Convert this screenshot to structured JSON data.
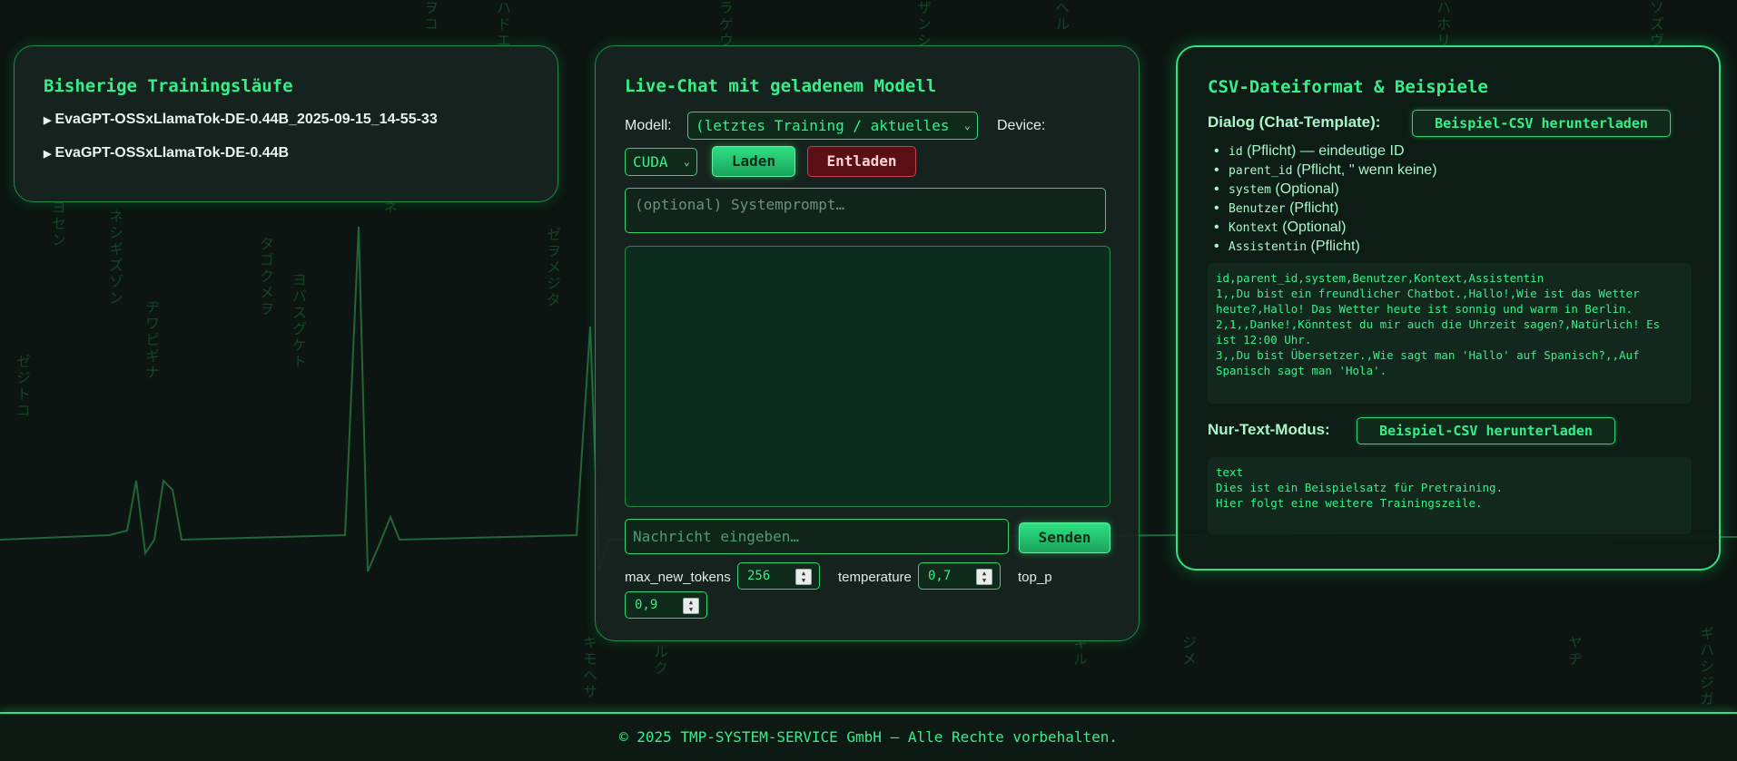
{
  "history": {
    "title": "Bisherige Trainingsläufe",
    "runs": [
      {
        "label": "EvaGPT-OSSxLlamaTok-DE-0.44B_2025-09-15_14-55-33"
      },
      {
        "label": "EvaGPT-OSSxLlamaTok-DE-0.44B"
      }
    ]
  },
  "chat": {
    "title": "Live-Chat mit geladenem Modell",
    "model_label": "Modell:",
    "model_value": "(letztes Training / aktuelles",
    "device_label": "Device:",
    "device_value": "CUDA",
    "load_label": "Laden",
    "unload_label": "Entladen",
    "system_placeholder": "(optional) Systemprompt…",
    "message_placeholder": "Nachricht eingeben…",
    "send_label": "Senden",
    "params": {
      "max_new_tokens_label": "max_new_tokens",
      "max_new_tokens": "256",
      "temperature_label": "temperature",
      "temperature": "0,7",
      "top_p_label": "top_p",
      "top_p": "0,9"
    }
  },
  "csv": {
    "title": "CSV-Dateiformat & Beispiele",
    "dialog_label": "Dialog (Chat-Template):",
    "download_label": "Beispiel-CSV herunterladen",
    "fields": [
      {
        "code": "id",
        "desc": " (Pflicht) — eindeutige ID"
      },
      {
        "code": "parent_id",
        "desc": " (Pflicht, '' wenn keine)"
      },
      {
        "code": "system",
        "desc": " (Optional)"
      },
      {
        "code": "Benutzer",
        "desc": " (Pflicht)"
      },
      {
        "code": "Kontext",
        "desc": " (Optional)"
      },
      {
        "code": "Assistentin",
        "desc": " (Pflicht)"
      }
    ],
    "dialog_example": "id,parent_id,system,Benutzer,Kontext,Assistentin\n1,,Du bist ein freundlicher Chatbot.,Hallo!,Wie ist das Wetter heute?,Hallo! Das Wetter heute ist sonnig und warm in Berlin.\n2,1,,Danke!,Könntest du mir auch die Uhrzeit sagen?,Natürlich! Es ist 12:00 Uhr.\n3,,Du bist Übersetzer.,Wie sagt man 'Hallo' auf Spanisch?,,Auf Spanisch sagt man 'Hola'.",
    "text_label": "Nur-Text-Modus:",
    "text_download_label": "Beispiel-CSV herunterladen",
    "text_example": "text\nDies ist ein Beispielsatz für Pretraining.\nHier folgt eine weitere Trainingszeile."
  },
  "footer": {
    "text": "© 2025 TMP-SYSTEM-SERVICE GmbH — Alle Rechte vorbehalten."
  },
  "colors": {
    "accent": "#35f08a",
    "background": "#0c1511",
    "danger": "#5a0f14"
  },
  "icons": {
    "run_item": "triangle-right-icon",
    "select": "chevron-down-icon",
    "spinner": "spinner-arrows-icon"
  }
}
